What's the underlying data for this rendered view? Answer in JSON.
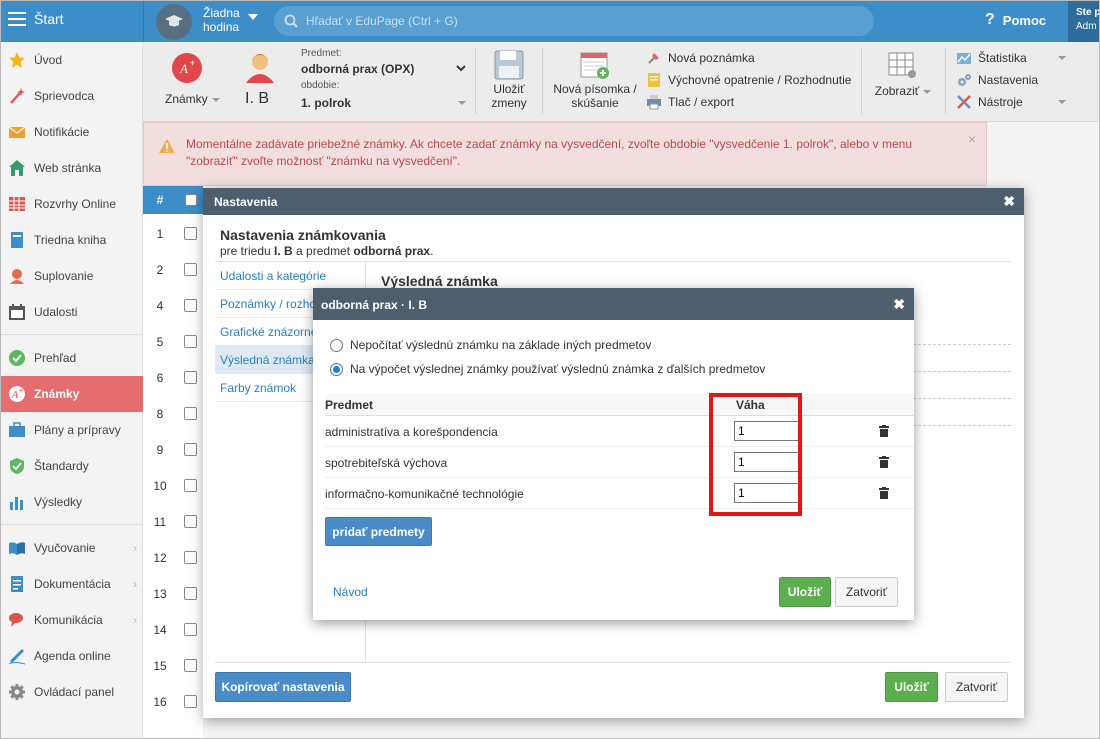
{
  "topbar": {
    "start_label": "Štart",
    "hour_label": "Žiadna hodina",
    "search_placeholder": "Hľadať v EduPage (Ctrl + G)",
    "help_label": "Pomoc",
    "user_line1": "Ste p",
    "user_line2": "Adm"
  },
  "sidebar": {
    "items": [
      {
        "label": "Úvod",
        "icon": "star-icon"
      },
      {
        "label": "Sprievodca",
        "icon": "wand-icon"
      },
      {
        "label": "Notifikácie",
        "icon": "envelope-icon"
      },
      {
        "label": "Web stránka",
        "icon": "house-icon"
      },
      {
        "label": "Rozvrhy Online",
        "icon": "timetable-icon"
      },
      {
        "label": "Triedna kniha",
        "icon": "book-icon"
      },
      {
        "label": "Suplovanie",
        "icon": "substitute-icon"
      },
      {
        "label": "Udalosti",
        "icon": "calendar-icon"
      },
      {
        "label": "Prehľad",
        "icon": "check-circle-icon"
      },
      {
        "label": "Známky",
        "icon": "grade-icon"
      },
      {
        "label": "Plány a prípravy",
        "icon": "briefcase-icon"
      },
      {
        "label": "Štandardy",
        "icon": "shield-icon"
      },
      {
        "label": "Výsledky",
        "icon": "bar-chart-icon"
      },
      {
        "label": "Vyučovanie",
        "icon": "open-book-icon"
      },
      {
        "label": "Dokumentácia",
        "icon": "document-icon"
      },
      {
        "label": "Komunikácia",
        "icon": "chat-icon"
      },
      {
        "label": "Agenda online",
        "icon": "pen-icon"
      },
      {
        "label": "Ovládací panel",
        "icon": "gear-icon"
      }
    ]
  },
  "toolbar": {
    "grades_label": "Známky",
    "class_label": "I. B",
    "subject_caption": "Predmet:",
    "subject_value": "odborná prax (OPX)",
    "period_caption": "obdobie:",
    "period_value": "1. polrok",
    "save_label": "Uložiť zmeny",
    "new_exam_label": "Nová písomka / skúšanie",
    "new_note_label": "Nová poznámka",
    "measure_label": "Výchovné opatrenie / Rozhodnutie",
    "print_label": "Tlač / export",
    "view_label": "Zobraziť",
    "stats_label": "Štatistika",
    "settings_label": "Nastavenia",
    "tools_label": "Nástroje"
  },
  "alert": {
    "text": "Momentálne zadávate priebežné známky. Ak chcete zadať známky na vysvedčení, zvoľte obdobie \"vysvedčenie 1. polrok\", alebo v menu \"zobraziť\" zvoľte možnosť \"známku na vysvedčení\"."
  },
  "bg_table": {
    "header": "#",
    "rows": [
      "1",
      "2",
      "4",
      "5",
      "6",
      "8",
      "9",
      "10",
      "11",
      "12",
      "13",
      "14",
      "15",
      "16"
    ]
  },
  "settings_dialog": {
    "header": "Nastavenia",
    "title": "Nastavenia známkovania",
    "subtitle_prefix": "pre triedu ",
    "subtitle_class": "I. B",
    "subtitle_mid": " a predmet ",
    "subtitle_subject": "odborná prax",
    "subtitle_end": ".",
    "nav": [
      "Udalosti a kategórie",
      "Poznámky / rozhodnutia",
      "Grafické znázornenie",
      "Výsledná známka",
      "Farby známok"
    ],
    "section_title": "Výsledná známka",
    "copy_button": "Kopírovať nastavenia",
    "save_button": "Uložiť",
    "close_button": "Zatvoriť"
  },
  "subject_dialog": {
    "header": "odborná prax · I. B",
    "option_1": "Nepočítať výslednú známku na základe iných predmetov",
    "option_2": "Na výpočet výslednej známky používať výslednú známka z ďalších predmetov",
    "col_subject": "Predmet",
    "col_weight": "Váha",
    "rows": [
      {
        "subject": "administratíva a korešpondencia",
        "weight": "1"
      },
      {
        "subject": "spotrebiteľská výchova",
        "weight": "1"
      },
      {
        "subject": "informačno-komunikačné technológie",
        "weight": "1"
      }
    ],
    "add_button": "pridať predmety",
    "help_link": "Návod",
    "save_button": "Uložiť",
    "close_button": "Zatvoriť"
  },
  "colors": {
    "topbar": "#3c8dc8",
    "active_sidebar": "#e46d6f",
    "dialog_header": "#4d5e6e",
    "save_green": "#5cae4e",
    "highlight_red": "#e0161b"
  }
}
